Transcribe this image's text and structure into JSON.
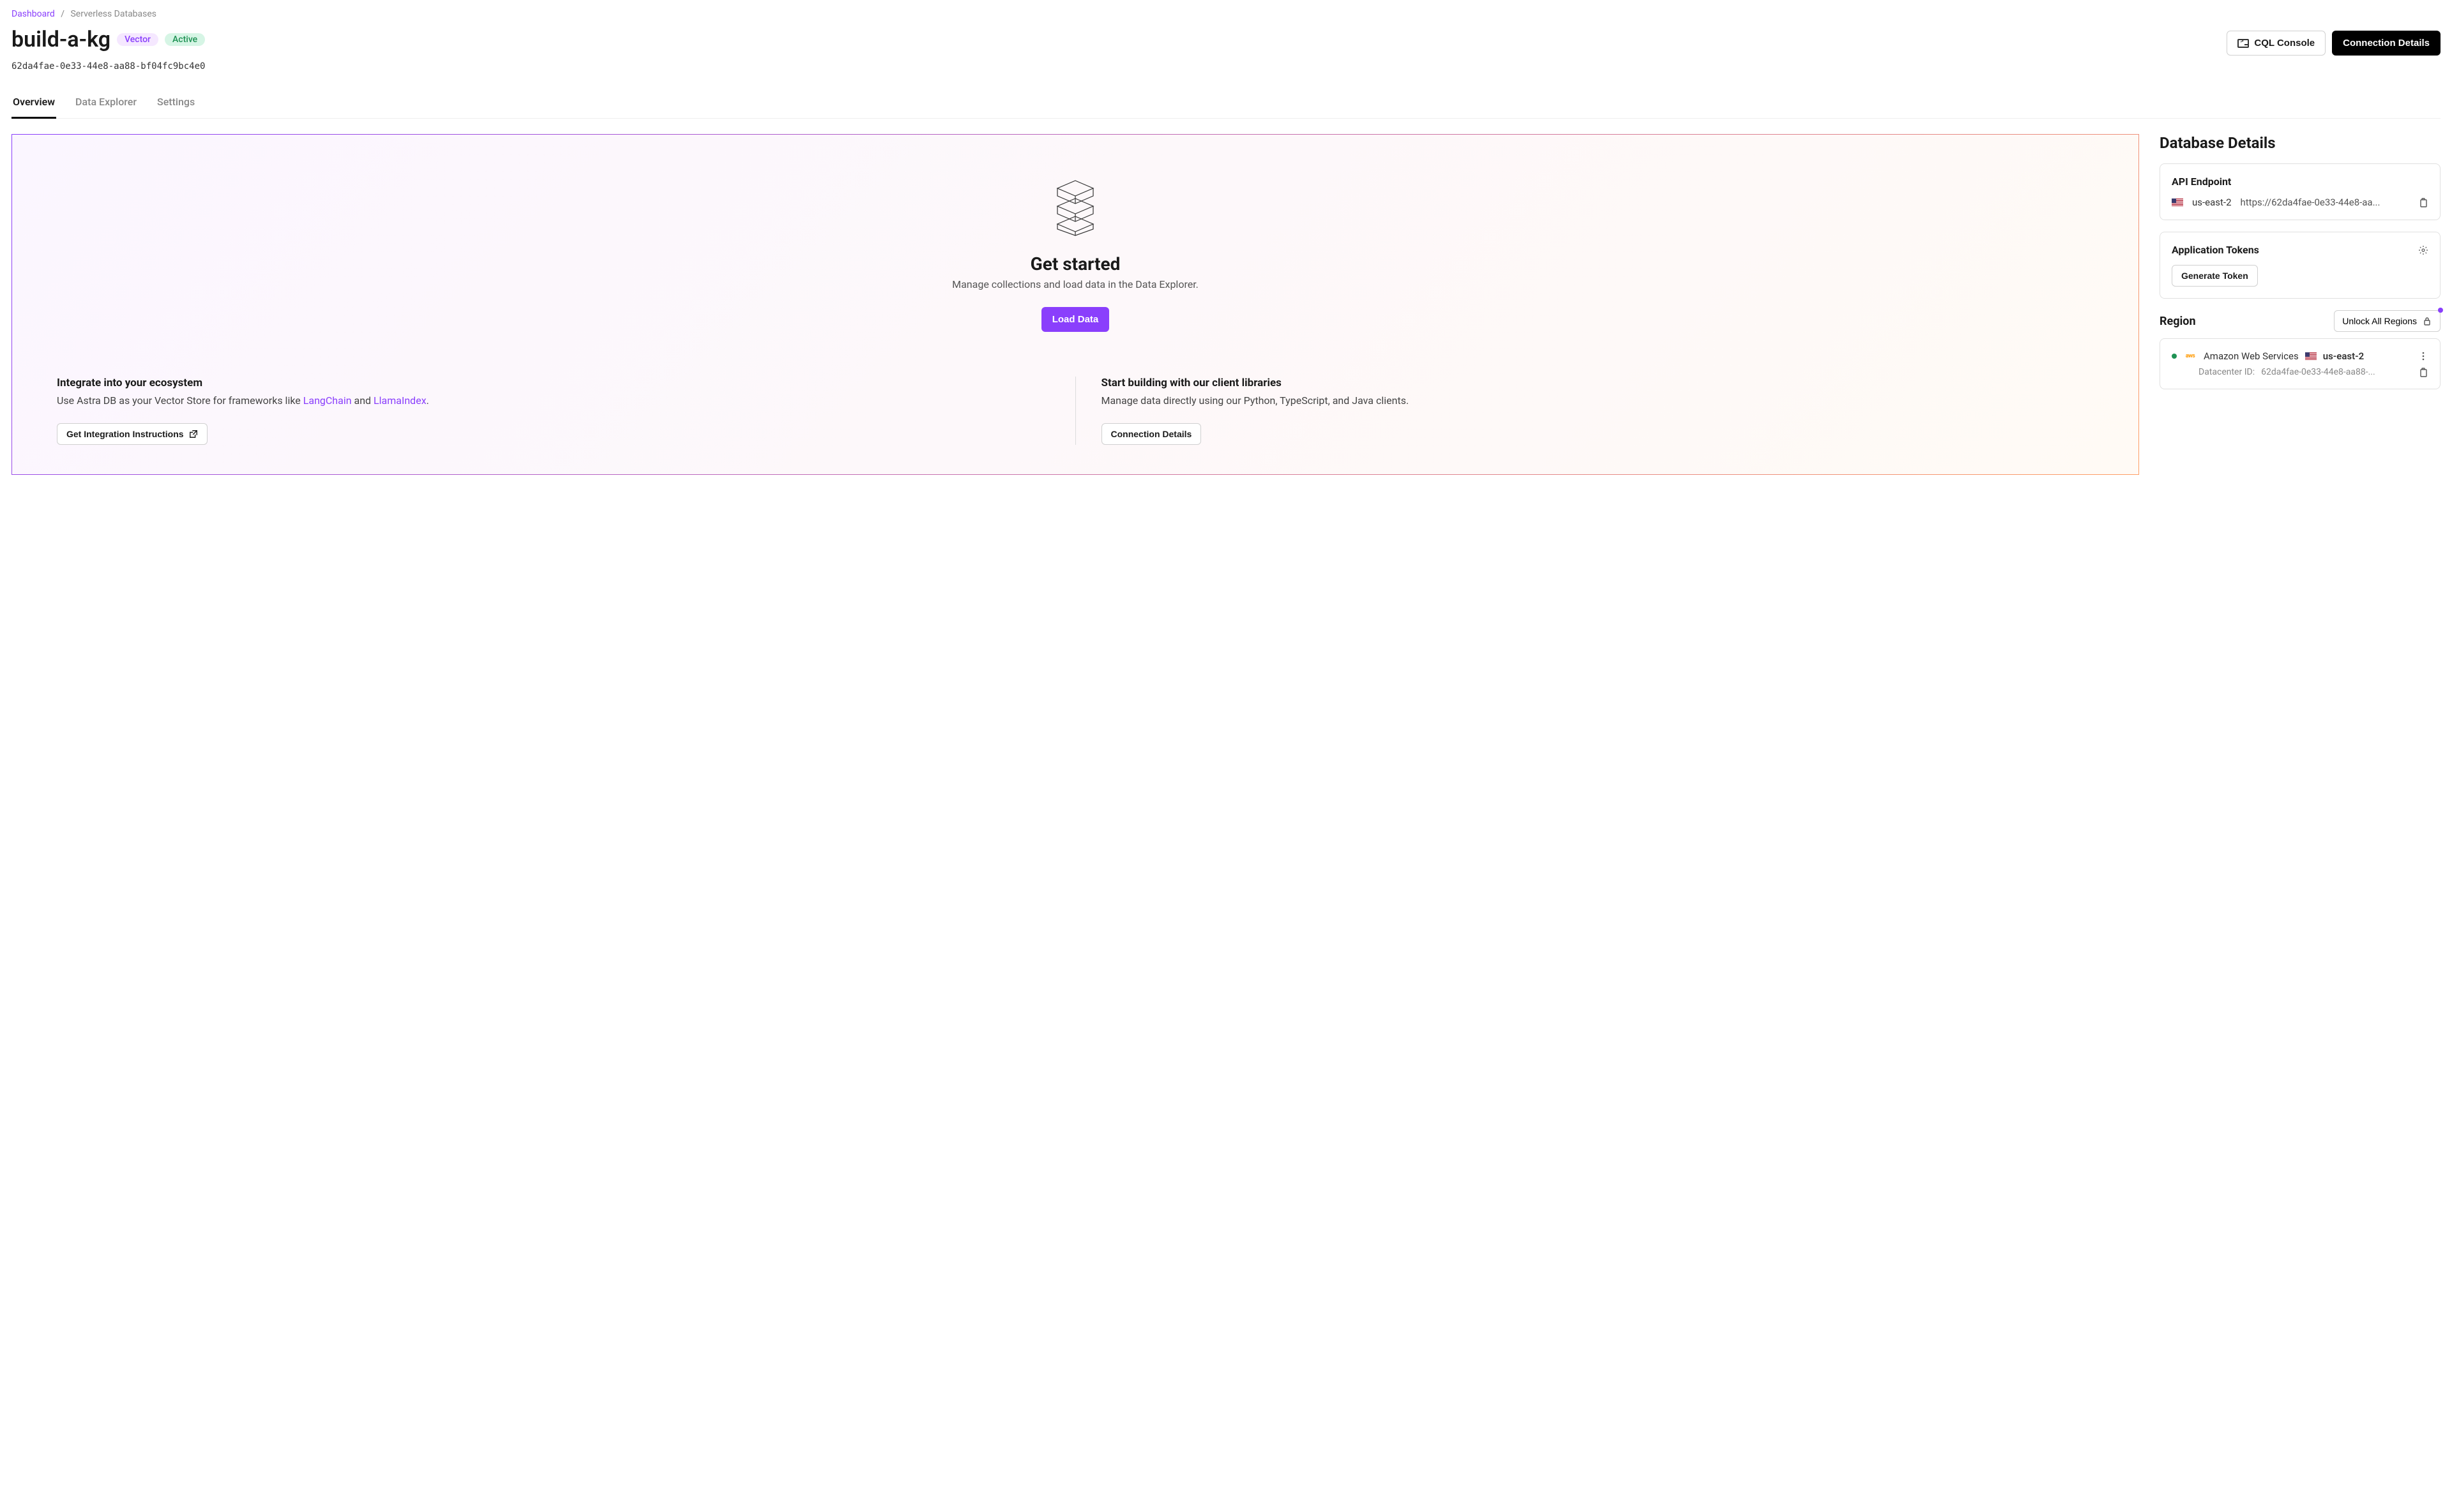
{
  "breadcrumb": {
    "root": "Dashboard",
    "current": "Serverless Databases"
  },
  "db": {
    "name": "build-a-kg",
    "badge_type": "Vector",
    "badge_status": "Active",
    "id": "62da4fae-0e33-44e8-aa88-bf04fc9bc4e0"
  },
  "header_actions": {
    "cql_console": "CQL Console",
    "connection_details": "Connection Details"
  },
  "tabs": {
    "overview": "Overview",
    "data_explorer": "Data Explorer",
    "settings": "Settings"
  },
  "hero": {
    "title": "Get started",
    "subtitle": "Manage collections and load data in the Data Explorer.",
    "load_data_btn": "Load Data",
    "integrate": {
      "title": "Integrate into your ecosystem",
      "body_prefix": "Use Astra DB as your Vector Store for frameworks like ",
      "link1": "LangChain",
      "body_mid": " and ",
      "link2": "LlamaIndex",
      "body_suffix": ".",
      "button": "Get Integration Instructions"
    },
    "build": {
      "title": "Start building with our client libraries",
      "body": "Manage data directly using our Python, TypeScript, and Java clients.",
      "button": "Connection Details"
    }
  },
  "details": {
    "section_title": "Database Details",
    "api_endpoint": {
      "heading": "API Endpoint",
      "region": "us-east-2",
      "url": "https://62da4fae-0e33-44e8-aa..."
    },
    "tokens": {
      "heading": "Application Tokens",
      "generate_btn": "Generate Token"
    },
    "region_section": {
      "heading": "Region",
      "unlock_btn": "Unlock All Regions",
      "items": [
        {
          "provider": "Amazon Web Services",
          "region": "us-east-2",
          "dc_id_label": "Datacenter ID:",
          "dc_id_value": "62da4fae-0e33-44e8-aa88-..."
        }
      ]
    }
  }
}
